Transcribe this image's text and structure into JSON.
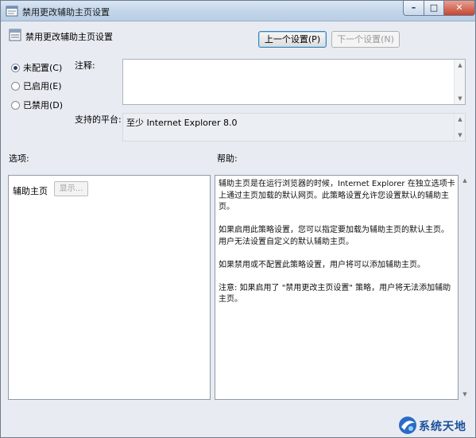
{
  "window": {
    "title": "禁用更改辅助主页设置",
    "controls": {
      "minimize": "–",
      "maximize": "□",
      "close": "✕"
    }
  },
  "header": {
    "title": "禁用更改辅助主页设置",
    "prev_button": "上一个设置(P)",
    "next_button": "下一个设置(N)"
  },
  "state_options": [
    {
      "label": "未配置(C)",
      "selected": true
    },
    {
      "label": "已启用(E)",
      "selected": false
    },
    {
      "label": "已禁用(D)",
      "selected": false
    }
  ],
  "comment": {
    "label": "注释:",
    "value": ""
  },
  "platform": {
    "label": "支持的平台:",
    "value": "至少 Internet Explorer 8.0"
  },
  "options_panel": {
    "label": "选项:",
    "item_label": "辅助主页",
    "show_button": "显示..."
  },
  "help_panel": {
    "label": "帮助:",
    "paragraphs": [
      "辅助主页是在运行浏览器的时候，Internet Explorer 在独立选项卡上通过主页加载的默认网页。此策略设置允许您设置默认的辅助主页。",
      "如果启用此策略设置，您可以指定要加载为辅助主页的默认主页。用户无法设置自定义的默认辅助主页。",
      "如果禁用或不配置此策略设置，用户将可以添加辅助主页。",
      "注意: 如果启用了 \"禁用更改主页设置\" 策略，用户将无法添加辅助主页。"
    ]
  },
  "watermark": {
    "text": "系统天地"
  },
  "colors": {
    "accent": "#3c7fb1",
    "window_bg": "#e8ecf2",
    "watermark": "#1b4f9c"
  }
}
